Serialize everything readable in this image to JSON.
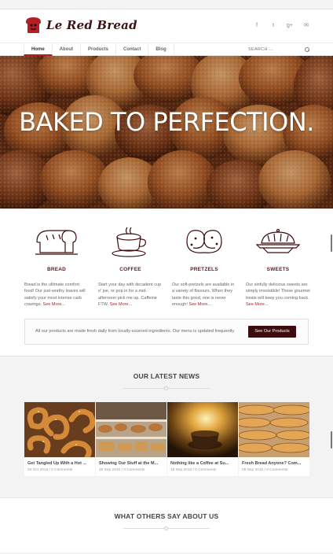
{
  "brand": {
    "name": "Le Red Bread",
    "accent": "#b22024",
    "dark": "#3d0c0f"
  },
  "social": [
    {
      "icon": "facebook-icon",
      "glyph": "f"
    },
    {
      "icon": "twitter-icon",
      "glyph": "t"
    },
    {
      "icon": "google-plus-icon",
      "glyph": "g+"
    },
    {
      "icon": "email-icon",
      "glyph": "✉"
    }
  ],
  "nav": {
    "items": [
      "Home",
      "About",
      "Products",
      "Contact",
      "Blog"
    ],
    "active": "Home",
    "search_placeholder": "SEARCH ..."
  },
  "hero": {
    "title": "BAKED TO PERFECTION."
  },
  "features": [
    {
      "icon": "bread-loaf-icon",
      "title": "BREAD",
      "desc": "Bread is the ultimate comfort food! Our just-worthy loaves will satisfy your most intense carb cravings.",
      "more": "See More..."
    },
    {
      "icon": "coffee-cup-icon",
      "title": "COFFEE",
      "desc": "Start your day with decadent cup o' joe, or pop in for a mid-afternoon pick me up. Caffeine FTW.",
      "more": "See More..."
    },
    {
      "icon": "pretzel-icon",
      "title": "PRETZELS",
      "desc": "Our soft-pretzels are available in a variety of flavours. When they taste this good, one is never enough!",
      "more": "See More..."
    },
    {
      "icon": "cake-icon",
      "title": "SWEETS",
      "desc": "Our sinfully delicious sweets are simply irresistible! These gourmet treats will keep you coming back.",
      "more": "See More..."
    }
  ],
  "cta": {
    "text": "All our products are made fresh daily from locally-sourced ingredients. Our menu is updated frequently.",
    "button": "See Our Products"
  },
  "news": {
    "title": "OUR LATEST NEWS",
    "items": [
      {
        "title": "Get Tangled Up With a Hot ...",
        "meta": "02 Oct 2015 / 2 Comments"
      },
      {
        "title": "Showing Our Stuff at the M...",
        "meta": "20 Sep 2015 / 0 Comments"
      },
      {
        "title": "Nothing like a Coffee at Su...",
        "meta": "15 Sep 2015 / 0 Comments"
      },
      {
        "title": "Fresh Bread Anyone? Com...",
        "meta": "05 Sep 2015 / 0 Comments"
      }
    ]
  },
  "testimonials": {
    "title": "WHAT OTHERS SAY ABOUT US"
  }
}
